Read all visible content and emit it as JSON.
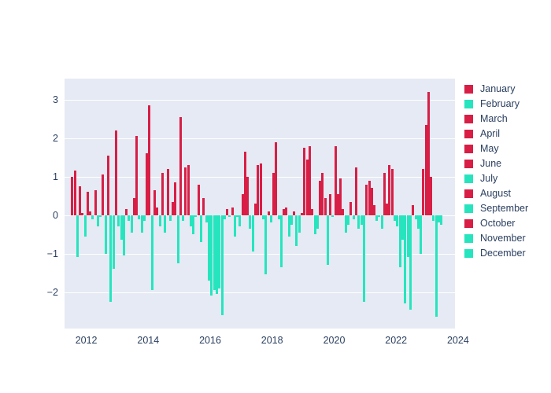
{
  "chart_data": {
    "type": "bar",
    "title": "",
    "subtitle": "",
    "xlabel": "",
    "ylabel": "",
    "xlim": [
      2011.3,
      2023.9
    ],
    "ylim": [
      -2.95,
      3.55
    ],
    "grid": true,
    "grid_axis": "y",
    "legend_position": "right",
    "plot_bgcolor": "#E5EAF4",
    "paper_bgcolor": "#FFFFFF",
    "positive_color": "#D81E45",
    "negative_color": "#26E5BE",
    "tick_color": "#2A3F5F",
    "yticks": [
      3,
      2,
      1,
      0,
      -1,
      -2
    ],
    "ytick_labels": [
      "3",
      "2",
      "1",
      "0",
      "−1",
      "−2"
    ],
    "xticks": [
      2012,
      2014,
      2016,
      2018,
      2020,
      2022,
      2024
    ],
    "xtick_labels": [
      "2012",
      "2014",
      "2016",
      "2018",
      "2020",
      "2022",
      "2024"
    ],
    "legend": [
      {
        "label": "January",
        "color": "#D81E45"
      },
      {
        "label": "February",
        "color": "#26E5BE"
      },
      {
        "label": "March",
        "color": "#D81E45"
      },
      {
        "label": "April",
        "color": "#D81E45"
      },
      {
        "label": "May",
        "color": "#D81E45"
      },
      {
        "label": "June",
        "color": "#D81E45"
      },
      {
        "label": "July",
        "color": "#26E5BE"
      },
      {
        "label": "August",
        "color": "#D81E45"
      },
      {
        "label": "September",
        "color": "#26E5BE"
      },
      {
        "label": "October",
        "color": "#D81E45"
      },
      {
        "label": "November",
        "color": "#26E5BE"
      },
      {
        "label": "December",
        "color": "#26E5BE"
      }
    ],
    "x": [
      2011.54,
      2011.63,
      2011.71,
      2011.79,
      2011.88,
      2011.96,
      2012.04,
      2012.13,
      2012.21,
      2012.29,
      2012.38,
      2012.46,
      2012.54,
      2012.63,
      2012.71,
      2012.79,
      2012.88,
      2012.96,
      2013.04,
      2013.13,
      2013.21,
      2013.29,
      2013.38,
      2013.46,
      2013.54,
      2013.63,
      2013.71,
      2013.79,
      2013.88,
      2013.96,
      2014.04,
      2014.13,
      2014.21,
      2014.29,
      2014.38,
      2014.46,
      2014.54,
      2014.63,
      2014.71,
      2014.79,
      2014.88,
      2014.96,
      2015.04,
      2015.13,
      2015.21,
      2015.29,
      2015.38,
      2015.46,
      2015.54,
      2015.63,
      2015.71,
      2015.79,
      2015.88,
      2015.96,
      2016.04,
      2016.13,
      2016.21,
      2016.29,
      2016.38,
      2016.46,
      2016.54,
      2016.63,
      2016.71,
      2016.79,
      2016.88,
      2016.96,
      2017.04,
      2017.13,
      2017.21,
      2017.29,
      2017.38,
      2017.46,
      2017.54,
      2017.63,
      2017.71,
      2017.79,
      2017.88,
      2017.96,
      2018.04,
      2018.13,
      2018.21,
      2018.29,
      2018.38,
      2018.46,
      2018.54,
      2018.63,
      2018.71,
      2018.79,
      2018.88,
      2018.96,
      2019.04,
      2019.13,
      2019.21,
      2019.29,
      2019.38,
      2019.46,
      2019.54,
      2019.63,
      2019.71,
      2019.79,
      2019.88,
      2019.96,
      2020.04,
      2020.13,
      2020.21,
      2020.29,
      2020.38,
      2020.46,
      2020.54,
      2020.63,
      2020.71,
      2020.79,
      2020.88,
      2020.96,
      2021.04,
      2021.13,
      2021.21,
      2021.29,
      2021.38,
      2021.46,
      2021.54,
      2021.63,
      2021.71,
      2021.79,
      2021.88,
      2021.96,
      2022.04,
      2022.13,
      2022.21,
      2022.29,
      2022.38,
      2022.46,
      2022.54,
      2022.63,
      2022.71,
      2022.79,
      2022.88,
      2022.96,
      2023.04,
      2023.13,
      2023.21,
      2023.29,
      2023.38,
      2023.46
    ],
    "values": [
      1.0,
      1.15,
      -1.1,
      0.75,
      0.05,
      -0.55,
      0.6,
      0.1,
      -0.1,
      0.65,
      -0.3,
      -0.05,
      1.05,
      -1.0,
      1.55,
      -2.25,
      -1.4,
      2.2,
      -0.3,
      -0.65,
      -1.05,
      0.15,
      -0.15,
      -0.45,
      0.45,
      2.05,
      -0.1,
      -0.45,
      -0.15,
      1.6,
      2.85,
      -1.95,
      0.65,
      0.2,
      -0.3,
      1.1,
      -0.45,
      1.2,
      -0.15,
      0.35,
      0.85,
      -1.25,
      2.55,
      -0.15,
      1.25,
      1.3,
      -0.3,
      -0.5,
      -0.05,
      0.8,
      -0.7,
      0.45,
      -0.2,
      -1.7,
      -2.1,
      -1.95,
      -2.05,
      -1.9,
      -2.6,
      -0.1,
      0.15,
      -0.05,
      0.2,
      -0.55,
      -0.05,
      -0.3,
      0.55,
      1.65,
      1.0,
      -0.35,
      -0.95,
      0.3,
      1.3,
      1.35,
      -0.1,
      -1.55,
      0.1,
      -0.2,
      1.1,
      1.9,
      -0.1,
      -1.35,
      0.15,
      0.2,
      -0.55,
      -0.25,
      0.1,
      -0.8,
      -0.45,
      0.05,
      1.75,
      1.45,
      1.8,
      0.15,
      -0.5,
      -0.35,
      0.9,
      1.1,
      0.45,
      -1.3,
      0.55,
      -0.05,
      1.8,
      0.55,
      0.95,
      0.15,
      -0.45,
      -0.25,
      0.35,
      -0.1,
      1.25,
      -0.35,
      -0.25,
      -2.25,
      0.8,
      0.9,
      0.7,
      0.25,
      -0.15,
      -0.05,
      -0.35,
      1.1,
      0.3,
      1.3,
      1.2,
      -0.15,
      -0.3,
      -1.35,
      -0.65,
      -2.3,
      -1.1,
      -2.45,
      0.25,
      -0.1,
      -0.35,
      -1.0,
      1.2,
      2.35,
      3.2,
      1.0,
      -0.15,
      -2.65,
      -0.2,
      -0.25
    ]
  }
}
